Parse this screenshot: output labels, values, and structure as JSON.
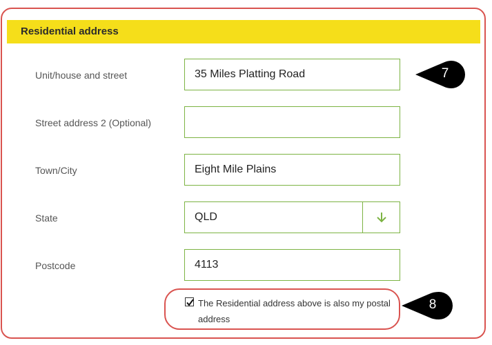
{
  "section": {
    "title": "Residential address"
  },
  "fields": {
    "street": {
      "label": "Unit/house and street",
      "value": "35 Miles Platting Road"
    },
    "street2": {
      "label": "Street address 2 (Optional)",
      "value": ""
    },
    "town": {
      "label": "Town/City",
      "value": "Eight Mile Plains"
    },
    "state": {
      "label": "State",
      "value": "QLD"
    },
    "postcode": {
      "label": "Postcode",
      "value": "4113"
    }
  },
  "postal_checkbox": {
    "checked": true,
    "label": "The Residential address above is also my postal address"
  },
  "callouts": {
    "first": "7",
    "second": "8"
  },
  "colors": {
    "header_bg": "#f5de1a",
    "input_border": "#7cb342",
    "highlight_border": "#d9534f",
    "callout_bg": "#000000"
  },
  "icons": {
    "state_dropdown": "arrow-down-icon",
    "checkbox": "checkmark-icon"
  }
}
